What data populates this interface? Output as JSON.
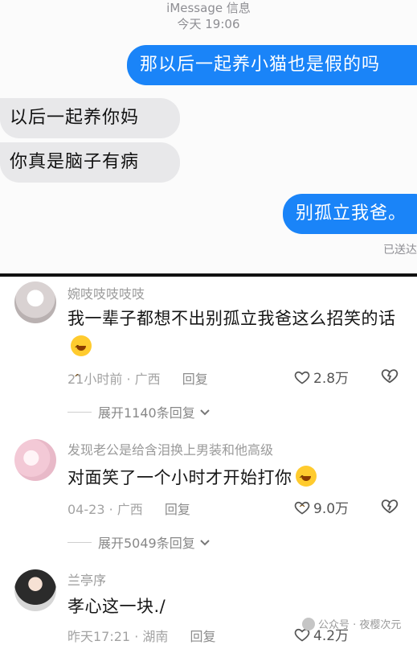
{
  "imessage": {
    "header": "iMessage 信息",
    "time": "今天 19:06",
    "messages": [
      {
        "side": "out",
        "text": "那以后一起养小猫也是假的吗"
      },
      {
        "side": "in",
        "text": "以后一起养你妈"
      },
      {
        "side": "in",
        "text": "你真是脑子有病"
      },
      {
        "side": "out",
        "text": "别孤立我爸。"
      }
    ],
    "status": "已送达"
  },
  "comments": [
    {
      "user": "婉吱吱吱吱吱",
      "text": "我一辈子都想不出别孤立我爸这么招笑的话",
      "time": "21小时前",
      "location": "广西",
      "reply": "回复",
      "likes": "2.8万",
      "expand": "展开1140条回复"
    },
    {
      "user": "发现老公是给含泪换上男装和他高级",
      "text": "对面笑了一个小时才开始打你",
      "time": "04-23",
      "location": "广西",
      "reply": "回复",
      "likes": "9.0万",
      "expand": "展开5049条回复"
    },
    {
      "user": "兰亭序",
      "text": "孝心这一块./",
      "time": "昨天17:21",
      "location": "湖南",
      "reply": "回复",
      "likes": "4.2万"
    }
  ],
  "watermark": "公众号 · 夜樱次元",
  "icons": {
    "like": "heart-outline-icon",
    "dislike": "broken-heart-icon",
    "expand": "chevron-down-icon",
    "emoji": "laughing-emoji-icon"
  },
  "colors": {
    "bubble_out": "#1a84f8",
    "bubble_in": "#e8e8ea",
    "meta_gray": "#a3a3a3"
  }
}
